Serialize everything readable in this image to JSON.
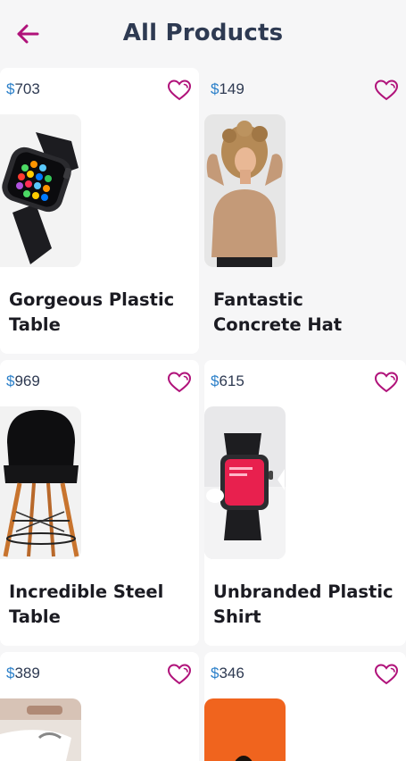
{
  "header": {
    "title": "All Products"
  },
  "products": [
    {
      "currency": "$",
      "price": "703",
      "name": "Gorgeous Plastic Table",
      "image": "smartwatch-black"
    },
    {
      "currency": "$",
      "price": "149",
      "name": "Fantastic Concrete Hat",
      "image": "woman-curly-hair"
    },
    {
      "currency": "$",
      "price": "969",
      "name": "Incredible Steel Table",
      "image": "black-chair"
    },
    {
      "currency": "$",
      "price": "615",
      "name": "Unbranded Plastic Shirt",
      "image": "smartwatch-red-screen"
    },
    {
      "currency": "$",
      "price": "389",
      "name": "",
      "image": "sneaker"
    },
    {
      "currency": "$",
      "price": "346",
      "name": "",
      "image": "orange-portrait"
    }
  ],
  "colors": {
    "accent": "#b0127a",
    "title": "#2e3a52",
    "currency": "#2a7fc9"
  }
}
